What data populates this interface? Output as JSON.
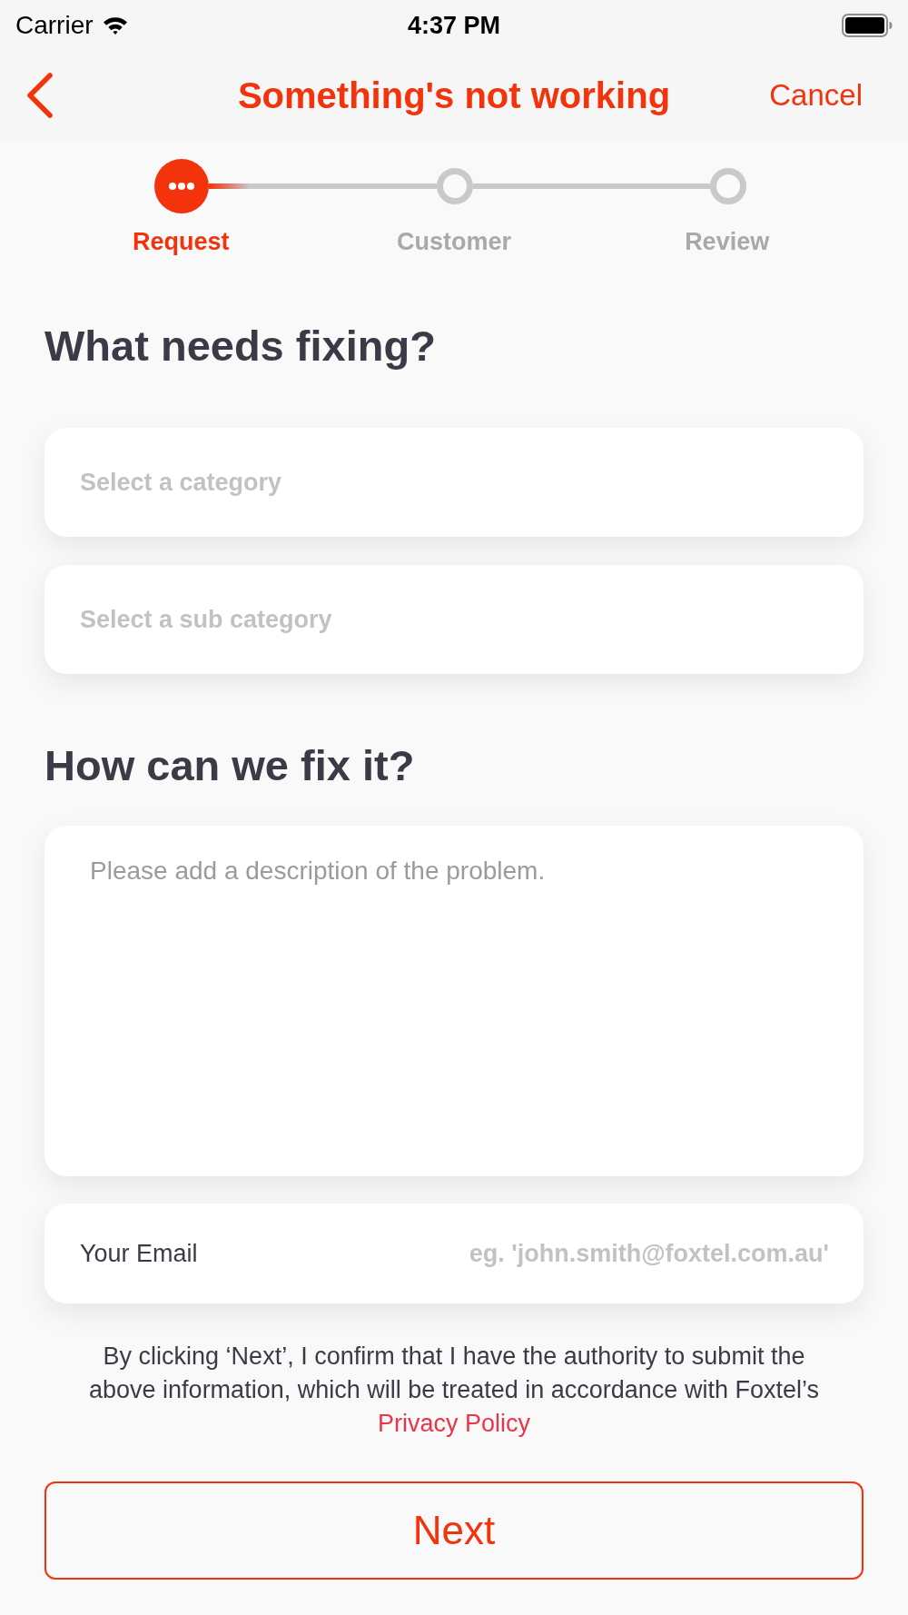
{
  "status_bar": {
    "carrier": "Carrier",
    "time": "4:37 PM"
  },
  "nav_bar": {
    "title": "Something's not working",
    "cancel": "Cancel"
  },
  "stepper": {
    "steps": [
      {
        "label": "Request",
        "selected": true
      },
      {
        "label": "Customer",
        "selected": false
      },
      {
        "label": "Review",
        "selected": false
      }
    ]
  },
  "fix_section": {
    "heading": "What needs fixing?",
    "selects": [
      {
        "placeholder": "Select a category"
      },
      {
        "placeholder": "Select a sub category"
      }
    ]
  },
  "how_section": {
    "heading": "How can we fix it?",
    "description": {
      "placeholder": "Please add a description of the problem."
    },
    "email": {
      "label": "Your Email",
      "placeholder": "eg. 'john.smith@foxtel.com.au'"
    }
  },
  "consent": {
    "text": "By clicking ‘Next’, I confirm that I have the authority to submit the above information, which will be treated in accordance with Foxtel’s",
    "link": "Privacy Policy"
  },
  "next_button": {
    "label": "Next"
  }
}
